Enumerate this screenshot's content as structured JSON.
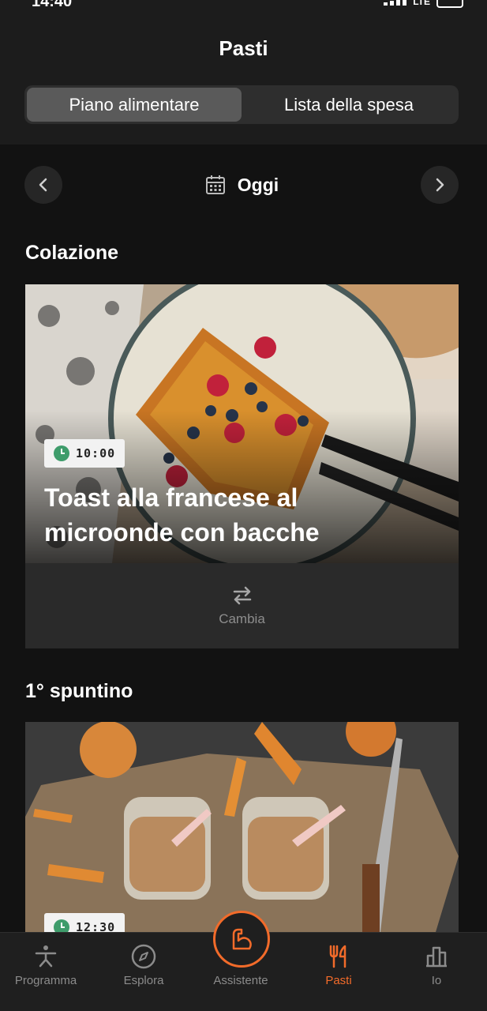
{
  "status": {
    "time": "14:40",
    "network": "LTE"
  },
  "header": {
    "title": "Pasti"
  },
  "segments": [
    {
      "label": "Piano alimentare",
      "active": true
    },
    {
      "label": "Lista della spesa",
      "active": false
    }
  ],
  "date_nav": {
    "label": "Oggi"
  },
  "meals": [
    {
      "section": "Colazione",
      "time": "10:00",
      "name": "Toast alla francese al microonde con bacche",
      "change_label": "Cambia"
    },
    {
      "section": "1° spuntino",
      "time": "12:30"
    }
  ],
  "tabbar": {
    "items": [
      {
        "label": "Programma",
        "icon": "program-icon"
      },
      {
        "label": "Esplora",
        "icon": "compass-icon"
      },
      {
        "label": "Assistente",
        "icon": "arm-icon"
      },
      {
        "label": "Pasti",
        "icon": "fork-knife-icon",
        "active": true
      },
      {
        "label": "Io",
        "icon": "stats-icon"
      }
    ]
  },
  "colors": {
    "accent": "#f26b2a",
    "clock": "#3e9c6b",
    "background": "#121212"
  }
}
